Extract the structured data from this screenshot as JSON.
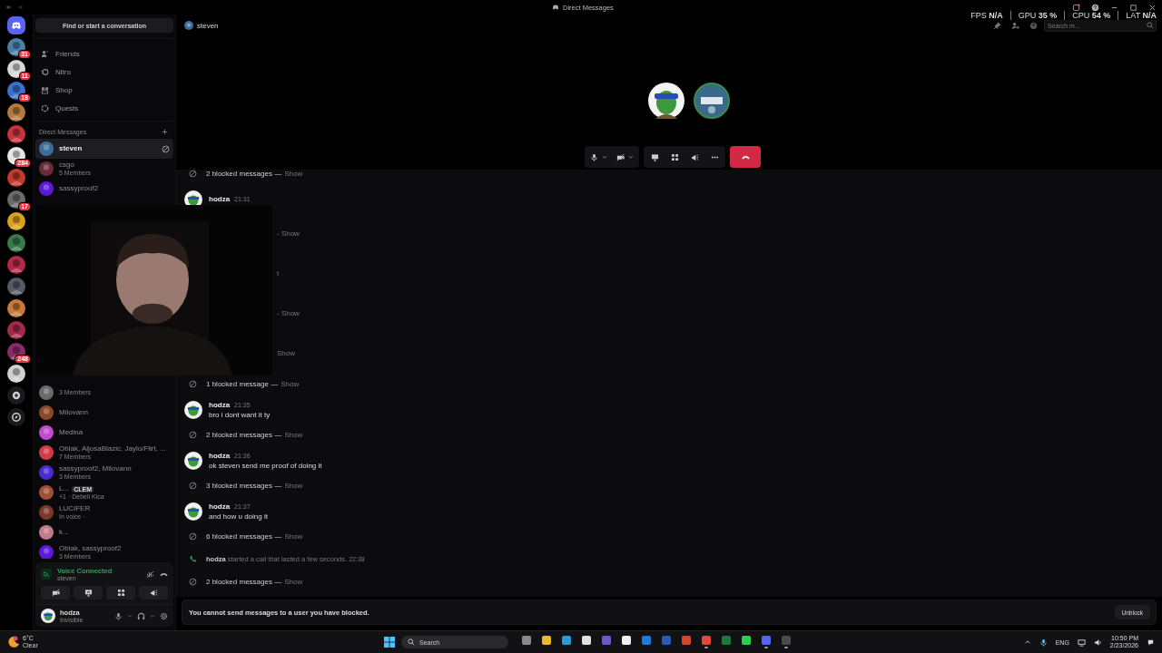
{
  "window": {
    "title": "Direct Messages"
  },
  "perf_overlay": [
    {
      "label": "FPS",
      "value": "N/A"
    },
    {
      "label": "GPU",
      "value": "35 %"
    },
    {
      "label": "CPU",
      "value": "54 %"
    },
    {
      "label": "LAT",
      "value": "N/A"
    }
  ],
  "servers": [
    {
      "kind": "discord"
    },
    {
      "kind": "picture",
      "badge": "31",
      "color": "#4a7fa8"
    },
    {
      "kind": "picture",
      "badge": "11",
      "color": "#d8d8d8"
    },
    {
      "kind": "picture",
      "badge": "18",
      "color": "#3d6fd1"
    },
    {
      "kind": "picture",
      "color": "#b37a3c"
    },
    {
      "kind": "picture",
      "color": "#c8323c"
    },
    {
      "kind": "picture",
      "badge": "284",
      "color": "#e6e6e6"
    },
    {
      "kind": "picture",
      "color": "#c23a2a"
    },
    {
      "kind": "picture",
      "badge": "17",
      "color": "#6a6a6a"
    },
    {
      "kind": "picture",
      "color": "#d9a21c"
    },
    {
      "kind": "picture",
      "color": "#3a7a4a"
    },
    {
      "kind": "picture",
      "color": "#b02a48"
    },
    {
      "kind": "picture",
      "color": "#555a66"
    },
    {
      "kind": "picture",
      "color": "#c87a3a"
    },
    {
      "kind": "picture",
      "color": "#a4284a"
    },
    {
      "kind": "picture",
      "badge": "248",
      "color": "#8a2a6a"
    },
    {
      "kind": "picture",
      "color": "#d0d0d0"
    },
    {
      "kind": "add"
    },
    {
      "kind": "discover"
    }
  ],
  "sidebar": {
    "search": "Find or start a conversation",
    "nav": [
      {
        "kind": "friends",
        "label": "Friends"
      },
      {
        "kind": "nitro",
        "label": "Nitro"
      },
      {
        "kind": "shop",
        "label": "Shop"
      },
      {
        "kind": "quests",
        "label": "Quests"
      }
    ],
    "dm_header": "Direct Messages",
    "dms_top": [
      {
        "name": "steven",
        "selected": true,
        "color": "#3b6e9a"
      },
      {
        "name": "csgo",
        "subtitle": "5 Members",
        "selected": false,
        "color": "#6a2a3a"
      },
      {
        "name": "sassyproof2",
        "selected": false,
        "color": "#5a1ad8"
      }
    ],
    "dms_bottom": [
      {
        "subtitle": "3 Members",
        "selected": false,
        "color": "#6a6a6a"
      },
      {
        "name": "Milovann",
        "selected": false,
        "color": "#8a4a2a"
      },
      {
        "name": "Medina",
        "selected": false,
        "color": "#c04ad0"
      },
      {
        "name": "Oblak, AljosaBlazic, Jaylo/Flirt, ...",
        "subtitle": "7 Members",
        "selected": false,
        "color": "#d03a4a"
      },
      {
        "name": "sassyproof2, Milovann",
        "subtitle": "3 Members",
        "selected": false,
        "color": "#4a2ad0"
      },
      {
        "name": "L...",
        "tag": "CLEM",
        "subtitle": "+1 · Debeli Kica",
        "selected": false,
        "color": "#a0503a"
      },
      {
        "name": "LUCIFER",
        "subtitle": "In voice ·",
        "selected": false,
        "color": "#7a3a2a"
      },
      {
        "name": "k...",
        "selected": false,
        "color": "#c07a8a"
      },
      {
        "name": "Oblak, sassyproof2",
        "subtitle": "3 Members",
        "selected": false,
        "color": "#5a1ad8"
      }
    ],
    "voice": {
      "status": "Voice Connected",
      "channel": "steven"
    },
    "user": {
      "name": "hodza",
      "status": "Invisible"
    }
  },
  "header": {
    "name": "steven",
    "search_placeholder": "Search m..."
  },
  "call_controls": [
    {
      "kind": "mic"
    },
    {
      "kind": "camera"
    },
    {
      "kind": "share"
    },
    {
      "kind": "activities"
    },
    {
      "kind": "soundboard"
    },
    {
      "kind": "more"
    },
    {
      "kind": "hangup"
    }
  ],
  "chat": [
    {
      "kind": "blocked",
      "text": "2 blocked messages —",
      "action": "Show"
    },
    {
      "kind": "message",
      "author": "hodza",
      "time": "21:31"
    },
    {
      "kind": "fragment",
      "text": "- Show"
    },
    {
      "kind": "fragment",
      "text": "t"
    },
    {
      "kind": "fragment",
      "text": "- Show"
    },
    {
      "kind": "fragment",
      "text": "Show"
    },
    {
      "kind": "blocked",
      "text": "1 blocked message —",
      "action": "Show"
    },
    {
      "kind": "message",
      "author": "hodza",
      "time": "21:35",
      "text": "bro i dont want it ty"
    },
    {
      "kind": "blocked",
      "text": "2 blocked messages —",
      "action": "Show"
    },
    {
      "kind": "message",
      "author": "hodza",
      "time": "21:36",
      "text": "ok steven send me proof of doing it"
    },
    {
      "kind": "blocked",
      "text": "3 blocked messages —",
      "action": "Show"
    },
    {
      "kind": "message",
      "author": "hodza",
      "time": "21:37",
      "text": "and how u doing it"
    },
    {
      "kind": "blocked",
      "text": "6 blocked messages —",
      "action": "Show"
    },
    {
      "kind": "call",
      "author": "hodza",
      "text": "started a call that lasted a few seconds.",
      "time": "22:38"
    },
    {
      "kind": "blocked",
      "text": "2 blocked messages —",
      "action": "Show"
    }
  ],
  "composer": {
    "notice": "You cannot send messages to a user you have blocked.",
    "button": "Unblock"
  },
  "taskbar": {
    "weather_temp": "6°C",
    "weather_text": "Clear",
    "search": "Search",
    "apps": [
      {
        "color": "#8a8a8a",
        "running": false
      },
      {
        "color": "#e8b830",
        "running": false
      },
      {
        "color": "#2a9ad8",
        "running": false
      },
      {
        "color": "#e0e0e0",
        "running": false
      },
      {
        "color": "#6a5ad0",
        "running": false
      },
      {
        "color": "#f0f0f0",
        "running": false
      },
      {
        "color": "#1a7ad8",
        "running": false
      },
      {
        "color": "#2a5ab8",
        "running": false
      },
      {
        "color": "#d04a2a",
        "running": false
      },
      {
        "color": "#e04a3a",
        "running": true
      },
      {
        "color": "#1a7a3a",
        "running": false
      },
      {
        "color": "#2ad04a",
        "running": false
      },
      {
        "color": "#5865f2",
        "running": true
      },
      {
        "color": "#4a4a4a",
        "running": true
      }
    ],
    "language": "ENG",
    "time": "10:50 PM",
    "date": "2/23/2026"
  }
}
